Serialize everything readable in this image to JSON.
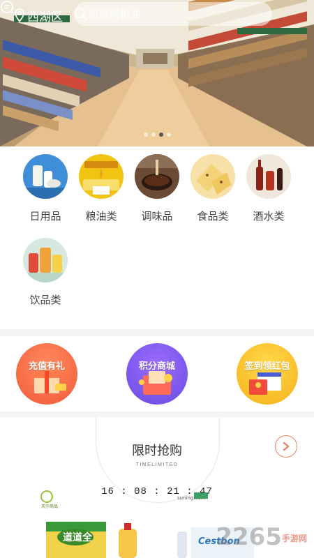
{
  "header": {
    "location": "西湖区",
    "search_placeholder": "热搜调和油"
  },
  "banner": {
    "slides": 4,
    "active_slide": 3
  },
  "categories": [
    {
      "label": "日用品"
    },
    {
      "label": "粮油类"
    },
    {
      "label": "调味品"
    },
    {
      "label": "食品类"
    },
    {
      "label": "酒水类"
    },
    {
      "label": "饮品类"
    }
  ],
  "promotions": [
    {
      "label": "充值有礼"
    },
    {
      "label": "积分商城"
    },
    {
      "label": "签到领红包"
    }
  ],
  "flash_sale": {
    "title": "限时抢购",
    "subtitle": "TIMELIMITED",
    "countdown": "16 : 08 : 21 : 47"
  },
  "products": [
    {
      "brand": "道道全",
      "logo": "天尔商品"
    },
    {
      "brand": "Cestbon",
      "store": "suning.com"
    }
  ],
  "watermark": {
    "number": "2265",
    "suffix": "手游网"
  }
}
